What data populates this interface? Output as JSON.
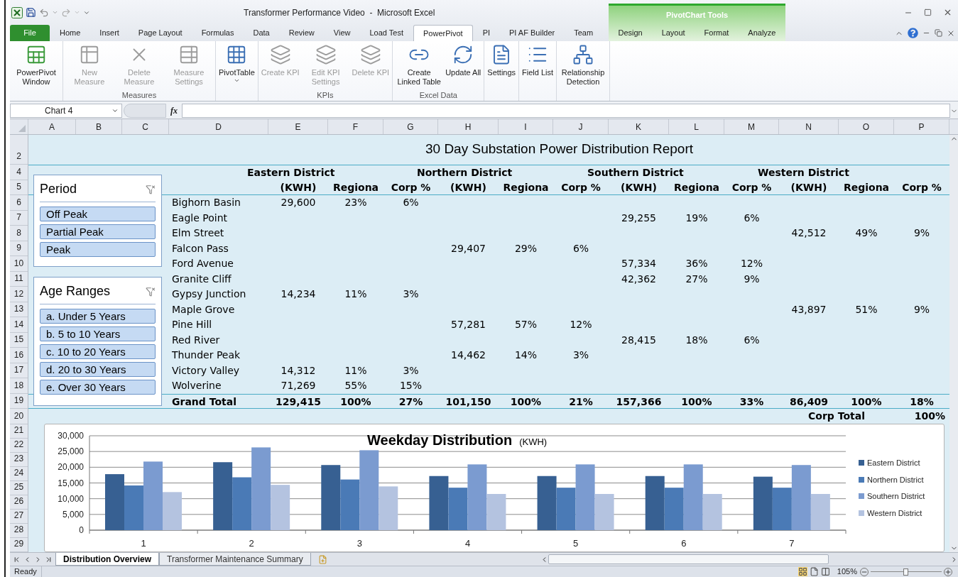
{
  "window": {
    "title": "Transformer Performance Video  -  Microsoft Excel"
  },
  "ribbon": {
    "tabs": [
      {
        "label": "File",
        "kind": "file",
        "selected": false
      },
      {
        "label": "Home",
        "kind": "tab",
        "selected": false
      },
      {
        "label": "Insert",
        "kind": "tab",
        "selected": false
      },
      {
        "label": "Page Layout",
        "kind": "tab",
        "selected": false
      },
      {
        "label": "Formulas",
        "kind": "tab",
        "selected": false
      },
      {
        "label": "Data",
        "kind": "tab",
        "selected": false
      },
      {
        "label": "Review",
        "kind": "tab",
        "selected": false
      },
      {
        "label": "View",
        "kind": "tab",
        "selected": false
      },
      {
        "label": "Load Test",
        "kind": "tab",
        "selected": false
      },
      {
        "label": "PowerPivot",
        "kind": "tab",
        "selected": true
      },
      {
        "label": "PI",
        "kind": "tab",
        "selected": false
      },
      {
        "label": "PI AF Builder",
        "kind": "tab",
        "selected": false
      },
      {
        "label": "Team",
        "kind": "tab",
        "selected": false
      }
    ],
    "contextual": {
      "label": "PivotChart Tools",
      "tabs": [
        {
          "label": "Design",
          "selected": false
        },
        {
          "label": "Layout",
          "selected": false
        },
        {
          "label": "Format",
          "selected": false
        },
        {
          "label": "Analyze",
          "selected": false
        }
      ]
    },
    "groups": [
      {
        "buttons": [
          {
            "label": "PowerPivot Window",
            "disabled": false
          }
        ]
      },
      {
        "label": "Measures",
        "buttons": [
          {
            "label": "New Measure",
            "disabled": true
          },
          {
            "label": "Delete Measure",
            "disabled": true
          },
          {
            "label": "Measure Settings",
            "disabled": true
          }
        ]
      },
      {
        "buttons": [
          {
            "label": "PivotTable",
            "disabled": false,
            "dropdown": true
          }
        ]
      },
      {
        "label": "KPIs",
        "buttons": [
          {
            "label": "Create KPI",
            "disabled": true
          },
          {
            "label": "Edit KPI Settings",
            "disabled": true
          },
          {
            "label": "Delete KPI",
            "disabled": true
          }
        ]
      },
      {
        "label": "Excel Data",
        "buttons": [
          {
            "label": "Create Linked Table",
            "disabled": false
          },
          {
            "label": "Update All",
            "disabled": false
          }
        ]
      },
      {
        "buttons": [
          {
            "label": "Settings",
            "disabled": false
          }
        ]
      },
      {
        "buttons": [
          {
            "label": "Field List",
            "disabled": false
          }
        ]
      },
      {
        "buttons": [
          {
            "label": "Relationship Detection",
            "disabled": false
          }
        ]
      }
    ]
  },
  "formula_bar": {
    "name_box": "Chart 4",
    "function_label": "fx"
  },
  "columns": [
    "A",
    "B",
    "C",
    "D",
    "E",
    "F",
    "G",
    "H",
    "I",
    "J",
    "K",
    "L",
    "M",
    "N",
    "O",
    "P"
  ],
  "row_numbers": [
    "2",
    "4",
    "5",
    "6",
    "7",
    "8",
    "9",
    "10",
    "11",
    "12",
    "13",
    "14",
    "15",
    "16",
    "17",
    "18",
    "19",
    "20",
    "21",
    "22",
    "23",
    "24",
    "25",
    "26",
    "27",
    "28",
    "29"
  ],
  "report": {
    "title": "30 Day Substation Power Distribution Report",
    "districts": [
      {
        "name": "Eastern District",
        "headers": [
          "(KWH)",
          "Regiona",
          "Corp %"
        ]
      },
      {
        "name": "Northern District",
        "headers": [
          "(KWH)",
          "Regiona",
          "Corp %"
        ]
      },
      {
        "name": "Southern District",
        "headers": [
          "(KWH)",
          "Regiona",
          "Corp %"
        ]
      },
      {
        "name": "Western District",
        "headers": [
          "(KWH)",
          "Regiona",
          "Corp %"
        ]
      }
    ],
    "rows": [
      {
        "name": "Bighorn Basin",
        "eastern": [
          "29,600",
          "23%",
          "6%"
        ]
      },
      {
        "name": "Eagle Point",
        "southern": [
          "29,255",
          "19%",
          "6%"
        ]
      },
      {
        "name": "Elm Street",
        "western": [
          "42,512",
          "49%",
          "9%"
        ]
      },
      {
        "name": "Falcon Pass",
        "northern": [
          "29,407",
          "29%",
          "6%"
        ]
      },
      {
        "name": "Ford Avenue",
        "southern": [
          "57,334",
          "36%",
          "12%"
        ]
      },
      {
        "name": "Granite Cliff",
        "southern": [
          "42,362",
          "27%",
          "9%"
        ]
      },
      {
        "name": "Gypsy Junction",
        "eastern": [
          "14,234",
          "11%",
          "3%"
        ]
      },
      {
        "name": "Maple Grove",
        "western": [
          "43,897",
          "51%",
          "9%"
        ]
      },
      {
        "name": "Pine Hill",
        "northern": [
          "57,281",
          "57%",
          "12%"
        ]
      },
      {
        "name": "Red River",
        "southern": [
          "28,415",
          "18%",
          "6%"
        ]
      },
      {
        "name": "Thunder Peak",
        "northern": [
          "14,462",
          "14%",
          "3%"
        ]
      },
      {
        "name": "Victory Valley",
        "eastern": [
          "14,312",
          "11%",
          "3%"
        ]
      },
      {
        "name": "Wolverine",
        "eastern": [
          "71,269",
          "55%",
          "15%"
        ]
      }
    ],
    "grand_total": {
      "name": "Grand Total",
      "eastern": [
        "129,415",
        "100%",
        "27%"
      ],
      "northern": [
        "101,150",
        "100%",
        "21%"
      ],
      "southern": [
        "157,366",
        "100%",
        "33%"
      ],
      "western": [
        "86,409",
        "100%",
        "18%"
      ]
    },
    "corp_total": {
      "label": "Corp Total",
      "value": "100%"
    }
  },
  "slicers": [
    {
      "title": "Period",
      "items": [
        {
          "label": "Off Peak",
          "selected": true
        },
        {
          "label": "Partial Peak",
          "selected": true
        },
        {
          "label": "Peak",
          "selected": true
        }
      ]
    },
    {
      "title": "Age Ranges",
      "items": [
        {
          "label": "a. Under 5 Years",
          "selected": true
        },
        {
          "label": "b. 5 to 10 Years",
          "selected": true
        },
        {
          "label": "c. 10 to 20 Years",
          "selected": true
        },
        {
          "label": "d. 20 to 30 Years",
          "selected": true
        },
        {
          "label": "e. Over 30 Years",
          "selected": true
        }
      ]
    }
  ],
  "chart": {
    "subtitle": "(KWH)",
    "chart_data": {
      "type": "bar",
      "title": "Weekday Distribution",
      "categories": [
        "1",
        "2",
        "3",
        "4",
        "5",
        "6",
        "7"
      ],
      "series": [
        {
          "name": "Eastern District",
          "color": "#376092",
          "values": [
            17800,
            21600,
            20700,
            17200,
            17200,
            17200,
            17000
          ]
        },
        {
          "name": "Northern District",
          "color": "#4a7ab6",
          "values": [
            14200,
            16800,
            16100,
            13500,
            13500,
            13500,
            13500
          ]
        },
        {
          "name": "Southern District",
          "color": "#7b9bd0",
          "values": [
            21800,
            26300,
            25400,
            20900,
            20900,
            20900,
            20700
          ]
        },
        {
          "name": "Western District",
          "color": "#b4c3e0",
          "values": [
            12100,
            14400,
            13900,
            11500,
            11500,
            11500,
            11500
          ]
        }
      ],
      "grid": true,
      "legend": true,
      "ylim": [
        0,
        30000
      ],
      "yticks": [
        {
          "value": 0,
          "label": "0"
        },
        {
          "value": 5000,
          "label": "5,000"
        },
        {
          "value": 10000,
          "label": "10,000"
        },
        {
          "value": 15000,
          "label": "15,000"
        },
        {
          "value": 20000,
          "label": "20,000"
        },
        {
          "value": 25000,
          "label": "25,000"
        },
        {
          "value": 30000,
          "label": "30,000"
        }
      ]
    }
  },
  "sheet_tabs": [
    {
      "label": "Distribution Overview",
      "selected": true
    },
    {
      "label": "Transformer Maintenance Summary",
      "selected": false
    }
  ],
  "status_bar": {
    "text": "Ready",
    "zoom": "105%",
    "zoom_slider": {
      "level": 0.5
    }
  }
}
